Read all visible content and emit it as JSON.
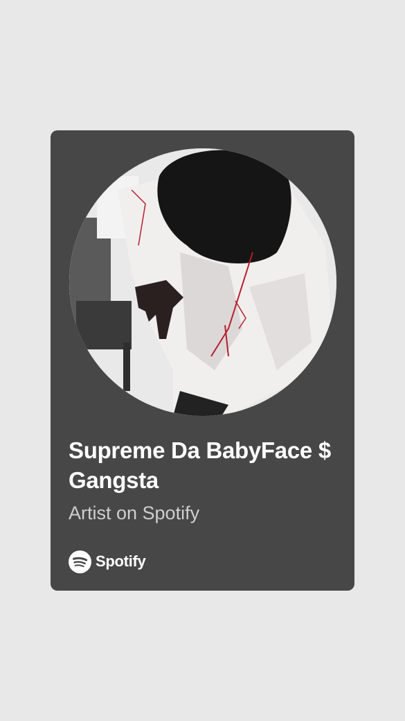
{
  "card": {
    "artist_name": "Supreme Da BabyFace $ Gangsta",
    "subtitle": "Artist on Spotify",
    "brand_name": "Spotify"
  },
  "icons": {
    "brand_icon": "spotify-logo-icon"
  },
  "colors": {
    "page_background": "#e8e8e8",
    "card_background": "#474747",
    "title_text": "#ffffff",
    "subtitle_text": "#cfcfcf"
  }
}
